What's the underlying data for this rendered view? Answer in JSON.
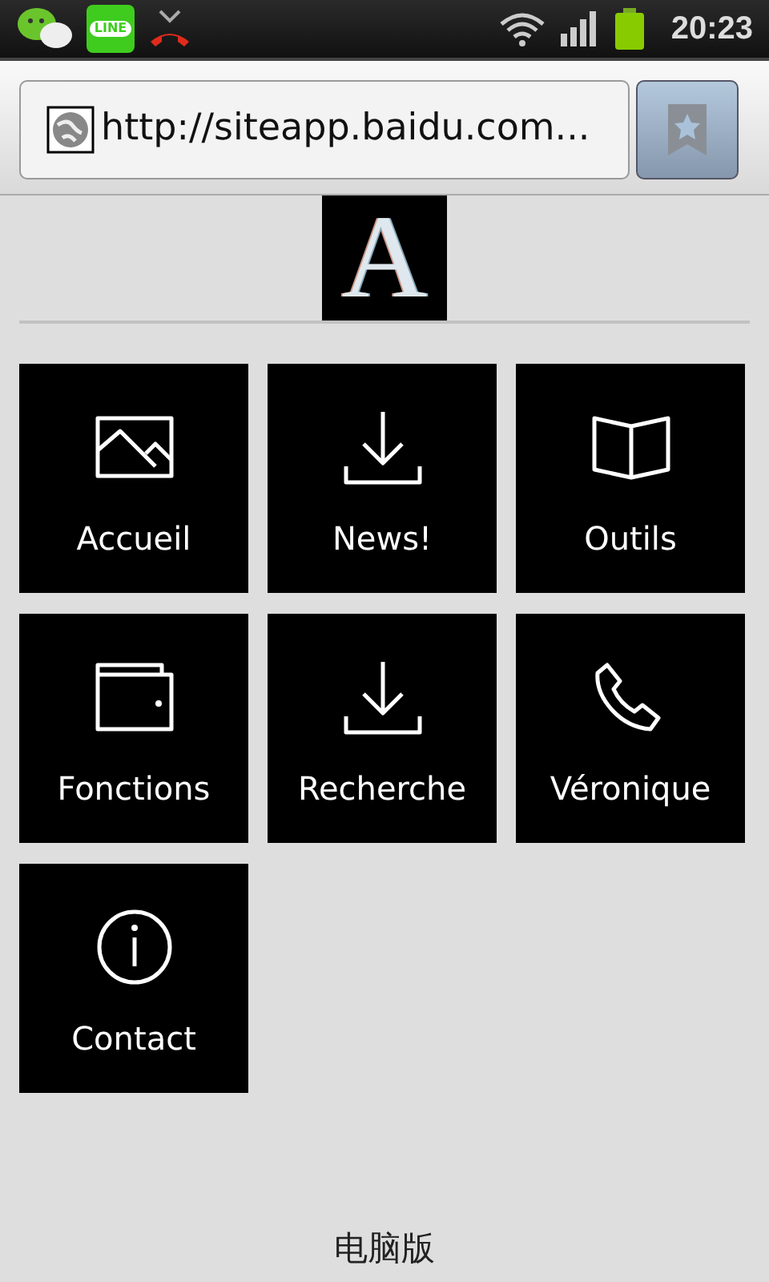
{
  "status_bar": {
    "app_badge": "LINE",
    "time": "20:23"
  },
  "address_bar": {
    "url": "http://siteapp.baidu.com..."
  },
  "logo": {
    "letter": "A"
  },
  "tiles": [
    {
      "label": "Accueil"
    },
    {
      "label": "News!"
    },
    {
      "label": "Outils"
    },
    {
      "label": "Fonctions"
    },
    {
      "label": "Recherche"
    },
    {
      "label": "Véronique"
    },
    {
      "label": "Contact"
    }
  ],
  "footer": {
    "link": "电脑版"
  }
}
